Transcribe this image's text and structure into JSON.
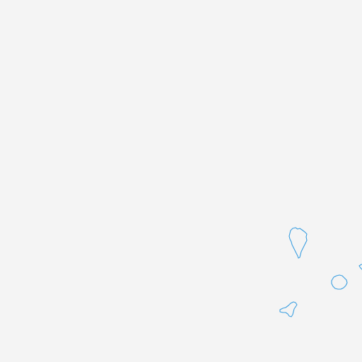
{
  "map": {
    "background_color": "#f4f4f4",
    "coastline_color": "#3a9ee0",
    "features": [
      {
        "id": "island-la-palma",
        "kind": "island-outline"
      },
      {
        "id": "island-la-gomera",
        "kind": "island-outline"
      },
      {
        "id": "island-el-hierro",
        "kind": "island-outline"
      },
      {
        "id": "island-tenerife-edge",
        "kind": "island-outline",
        "partial": true
      }
    ]
  }
}
